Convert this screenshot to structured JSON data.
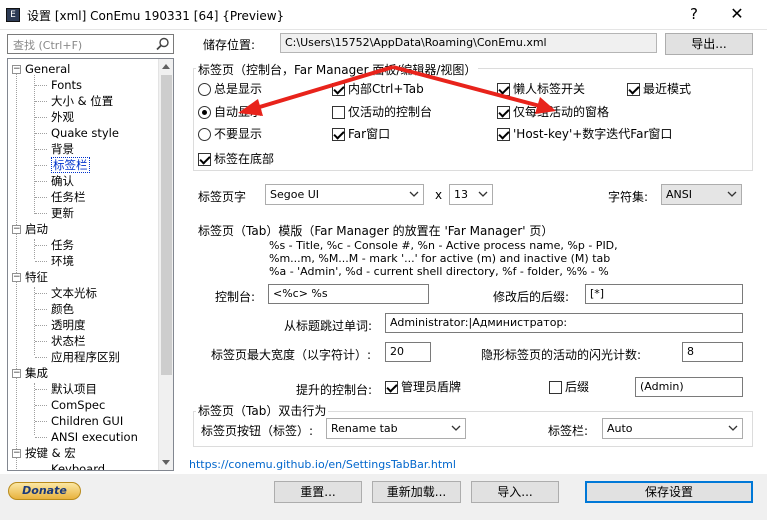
{
  "window": {
    "title": "设置 [xml] ConEmu 190331 [64] {Preview}",
    "app_icon_glyph": "E",
    "help_glyph": "?",
    "close_glyph": "✕"
  },
  "search": {
    "placeholder": "查找 (Ctrl+F)"
  },
  "tree": {
    "general": "General",
    "fonts": "Fonts",
    "size_pos": "大小 & 位置",
    "appearance": "外观",
    "quake": "Quake style",
    "background": "背景",
    "tabbar": "标签栏",
    "confirm": "确认",
    "taskbar": "任务栏",
    "update": "更新",
    "startup": "启动",
    "tasks": "任务",
    "environment": "环境",
    "features": "特征",
    "text_cursor": "文本光标",
    "colors": "颜色",
    "transparency": "透明度",
    "status_bar": "状态栏",
    "app_distinct": "应用程序区别",
    "integration": "集成",
    "default_term": "默认项目",
    "comspec": "ComSpec",
    "children_gui": "Children GUI",
    "ansi_exec": "ANSI execution",
    "keys_macro": "按键 & 宏",
    "keyboard": "Keyboard",
    "expander_minus": "−"
  },
  "donate_label": "Donate",
  "storage": {
    "label": "储存位置:",
    "path": "C:\\Users\\15752\\AppData\\Roaming\\ConEmu.xml",
    "export_btn": "导出..."
  },
  "tabs_group": {
    "title": "标签页（控制台，Far Manager 面板/编辑器/视图）",
    "always_show": "总是显示",
    "auto_show": "自动显示",
    "dont_show": "不要显示",
    "internal_ctrl_tab": "内部Ctrl+Tab",
    "only_active_console": "仅活动的控制台",
    "far_windows": "Far窗口",
    "lazy_tab_switch": "懒人标签开关",
    "recent_mode": "最近模式",
    "only_active_panes": "仅每组活动的窗格",
    "hostkey_far": "'Host-key'+数字迭代Far窗口",
    "tabs_on_bottom": "标签在底部"
  },
  "font": {
    "label": "标签页字",
    "family": "Segoe UI",
    "x_label": "x",
    "size": "13",
    "charset_label": "字符集:",
    "charset": "ANSI"
  },
  "template": {
    "heading": "标签页（Tab）模版（Far Manager 的放置在 'Far Manager' 页）",
    "help1": "%s - Title, %c - Console #, %n - Active process name, %p - PID,",
    "help2": "%m...m, %M...M - mark '...' for active (m) and inactive (M) tab",
    "help3": "%a - 'Admin', %d - current shell directory, %f - folder, %% - %",
    "console_label": "控制台:",
    "console_value": "<%c> %s",
    "modified_label": "修改后的后缀:",
    "modified_value": "[*]",
    "skip_words_label": "从标题跳过单词:",
    "skip_words_value": "Administrator:|Администратор:",
    "max_width_label": "标签页最大宽度（以字符计）:",
    "max_width_value": "20",
    "flash_label": "隐形标签页的活动的闪光计数:",
    "flash_value": "8",
    "elevated_label": "提升的控制台:",
    "admin_shield": "管理员盾牌",
    "suffix": "后缀",
    "suffix_value": "(Admin)"
  },
  "dblclick": {
    "heading": "标签页（Tab）双击行为",
    "tab_button_label": "标签页按钮（标签）:",
    "tab_button_value": "Rename tab",
    "tabbar_label": "标签栏:",
    "tabbar_value": "Auto"
  },
  "link": "https://conemu.github.io/en/SettingsTabBar.html",
  "buttons": {
    "reset": "重置...",
    "reload": "重新加载...",
    "import": "导入...",
    "save": "保存设置"
  },
  "colors": {
    "arrow": "#e8231b",
    "link": "#0066cc",
    "selected": "#0033cc"
  },
  "icons": {
    "search": "search-icon",
    "chevron": "chevron-down-icon"
  }
}
